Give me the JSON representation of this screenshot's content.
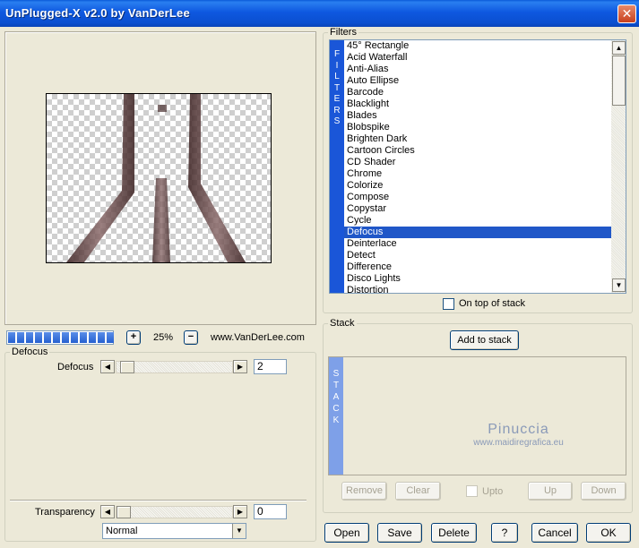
{
  "window": {
    "title": "UnPlugged-X v2.0 by VanDerLee",
    "close_glyph": "✕"
  },
  "preview": {
    "zoom_minus": "−",
    "zoom_plus": "+",
    "zoom_value": "25%",
    "site_text": "www.VanDerLee.com",
    "progress_fraction": 1.0
  },
  "defocus_group": {
    "label": "Defocus",
    "param_label": "Defocus",
    "param_value": "2",
    "param_value_numeric": 2
  },
  "transparency": {
    "label": "Transparency",
    "value": "0",
    "value_numeric": 0,
    "blend_mode": "Normal"
  },
  "filters_group": {
    "label": "Filters",
    "band_letters": [
      "F",
      "I",
      "L",
      "T",
      "E",
      "R",
      "S"
    ],
    "items": [
      "45° Rectangle",
      "Acid Waterfall",
      "Anti-Alias",
      "Auto Ellipse",
      "Barcode",
      "Blacklight",
      "Blades",
      "Blobspike",
      "Brighten Dark",
      "Cartoon Circles",
      "CD Shader",
      "Chrome",
      "Colorize",
      "Compose",
      "Copystar",
      "Cycle",
      "Defocus",
      "Deinterlace",
      "Detect",
      "Difference",
      "Disco Lights",
      "Distortion"
    ],
    "selected_index": 16,
    "on_top_label": "On top of stack"
  },
  "stack_group": {
    "label": "Stack",
    "add_button": "Add to stack",
    "band_letters": [
      "S",
      "T",
      "A",
      "C",
      "K"
    ],
    "remove_button": "Remove",
    "clear_button": "Clear",
    "upto_label": "Upto",
    "up_button": "Up",
    "down_button": "Down"
  },
  "watermark": {
    "title": "Pinuccia",
    "subtitle": "www.maidiregrafica.eu"
  },
  "footer": {
    "open": "Open",
    "save": "Save",
    "delete": "Delete",
    "help": "?",
    "cancel": "Cancel",
    "ok": "OK"
  },
  "icons": {
    "scroll_up": "▲",
    "scroll_down": "▼",
    "arrow_left": "◀",
    "arrow_right": "▶",
    "dropdown": "▼"
  },
  "colors": {
    "title_bar": "#0b4fd0",
    "selection": "#2057c8",
    "filters_band": "#1a56d8",
    "stack_band": "#7ea0e8"
  }
}
